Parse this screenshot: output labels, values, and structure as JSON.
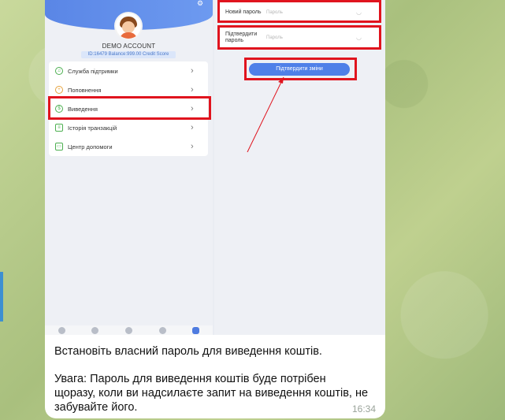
{
  "account": {
    "name": "DEMO ACCOUNT",
    "info": "ID:16479  Balance:999.00  Credit Score"
  },
  "menu": [
    {
      "label": "Служба підтримки",
      "icon": "headset-icon"
    },
    {
      "label": "Поповнення",
      "icon": "deposit-icon"
    },
    {
      "label": "Виведення",
      "icon": "withdraw-icon"
    },
    {
      "label": "Історія транзакцій",
      "icon": "history-icon"
    },
    {
      "label": "Центр допомоги",
      "icon": "help-icon"
    }
  ],
  "form": {
    "new_password_label": "Новий пароль",
    "confirm_password_label": "Підтвердити пароль",
    "password_placeholder": "Пароль",
    "confirm_button": "Підтвердити зміни"
  },
  "message": {
    "line1": "Встановіть власний пароль для виведення коштів.",
    "line2": "Увага: Пароль для виведення коштів буде потрібен щоразу, коли ви надсилаєте запит на виведення коштів, не забувайте його.",
    "time": "16:34"
  },
  "colors": {
    "highlight": "#e0141e",
    "accent_blue": "#4f80e8",
    "chat_background": "#b9cc8f"
  }
}
